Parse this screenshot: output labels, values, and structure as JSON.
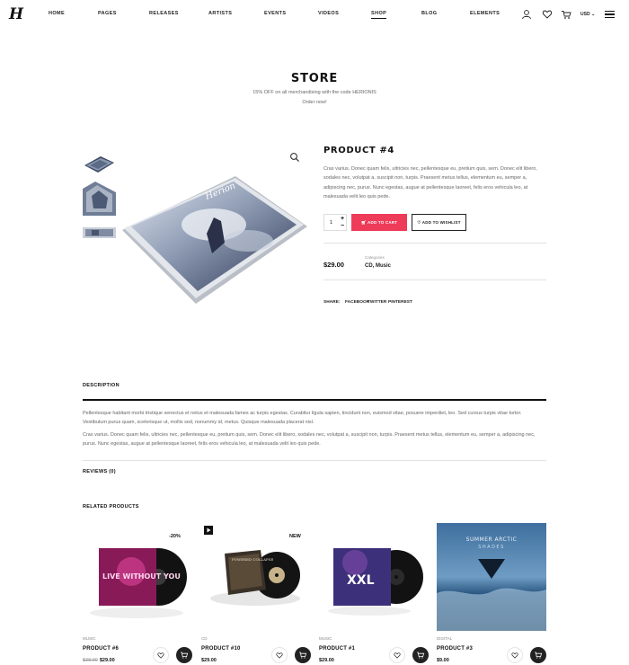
{
  "header": {
    "logo": "H",
    "nav": [
      "HOME",
      "PAGES",
      "RELEASES",
      "ARTISTS",
      "EVENTS",
      "VIDEOS",
      "SHOP",
      "BLOG",
      "ELEMENTS"
    ],
    "active_nav": "SHOP",
    "currency": "USD",
    "icons": [
      "user-icon",
      "heart-icon",
      "cart-icon",
      "chevron-down-icon",
      "menu-icon"
    ]
  },
  "store": {
    "title": "STORE",
    "promo_line1": "15% OFF on all merchandising with the code HERIONIS",
    "promo_line2": "Order now!"
  },
  "product": {
    "title": "PRODUCT #4",
    "description": "Cras varius. Donec quam felis, ultricies nec, pellentesque eu, pretium quis, sem. Donec elit libero, sodales nec, volutpat a, suscipit non, turpis. Praesent metus tellus, elementum eu, semper a, adipiscing nec, purus. Nunc egestas, augue at pellentesque laoreet, felis eros vehicula leo, at malesuada velit leo quis pede.",
    "quantity": "1",
    "add_to_cart": "ADD TO CART",
    "add_to_wishlist": "ADD TO WISHLIST",
    "price": "$29.00",
    "categories_label": "Categories",
    "category": "CD, Music",
    "cover_text": "Herion",
    "share_label": "Share:",
    "share_links": [
      "FACEBOOK",
      "TWITTER",
      "PINTEREST"
    ]
  },
  "tabs": {
    "description_label": "DESCRIPTION",
    "paragraph1": "Pellentesque habitant morbi tristique senectus et netus et malesuada fames ac turpis egestas. Curabitur ligula sapien, tincidunt non, euismod vitae, posuere imperdiet, leo. Sed cursus turpis vitae tortor. Vestibulum purus quam, scelerisque ut, mollis sed, nonummy id, metus. Quisque malesuada placerat nisl.",
    "paragraph2": "Cras varius. Donec quam felis, ultricies nec, pellentesque eu, pretium quis, sem. Donec elit libero, sodales nec, volutpat a, suscipit non, turpis. Praesent metus tellus, elementum eu, semper a, adipiscing nec, purus. Nunc egestas, augue at pellentesque laoreet, felis eros vehicula leo, at malesuada velit leo quis pede.",
    "reviews_label": "REVIEWS (0)"
  },
  "related": {
    "title": "RELATED PRODUCTS",
    "items": [
      {
        "category": "MUSIC",
        "name": "PRODUCT #6",
        "old_price": "$38.00",
        "price": "$29.00",
        "badge": "-20%",
        "cover_text": "LIVE WITHOUT YOU"
      },
      {
        "category": "CD",
        "name": "PRODUCT #10",
        "old_price": "",
        "price": "$29.00",
        "badge": "NEW",
        "cover_text": "POWERED COLLAPSE"
      },
      {
        "category": "MUSIC",
        "name": "PRODUCT #1",
        "old_price": "",
        "price": "$29.00",
        "badge": "",
        "cover_text": "XXL"
      },
      {
        "category": "DIGITAL",
        "name": "PRODUCT #3",
        "old_price": "",
        "price": "$9.00",
        "badge": "",
        "cover_text": "SUMMER ARCTIC",
        "cover_subtext": "SHADES"
      }
    ]
  },
  "colors": {
    "accent": "#ee3b59",
    "dark": "#222222",
    "text_muted": "#666666"
  }
}
